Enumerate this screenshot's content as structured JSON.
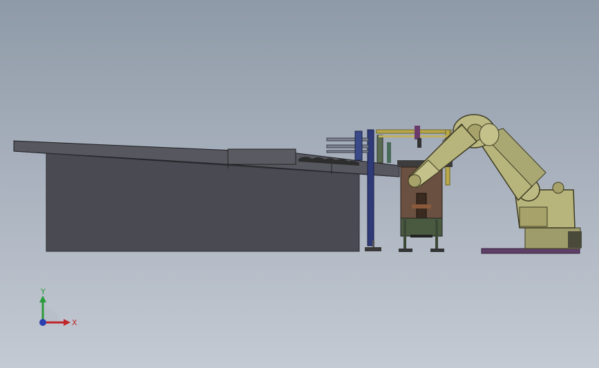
{
  "triad": {
    "x_label": "X",
    "y_label": "Y",
    "x_color": "#c0262a",
    "y_color": "#2a9a3a",
    "z_color": "#2a3fb0"
  },
  "colors": {
    "background_top": "#8f9aa8",
    "background_bottom": "#c4cad3",
    "conveyor_body": "#4a4a52",
    "robot_body": "#b7b47c",
    "frame_yellow": "#b8a84a",
    "base_plate": "#5e3f66",
    "cabinet_brown": "#6a5040"
  },
  "icons": {
    "triad": "coordinate-axes-icon"
  }
}
